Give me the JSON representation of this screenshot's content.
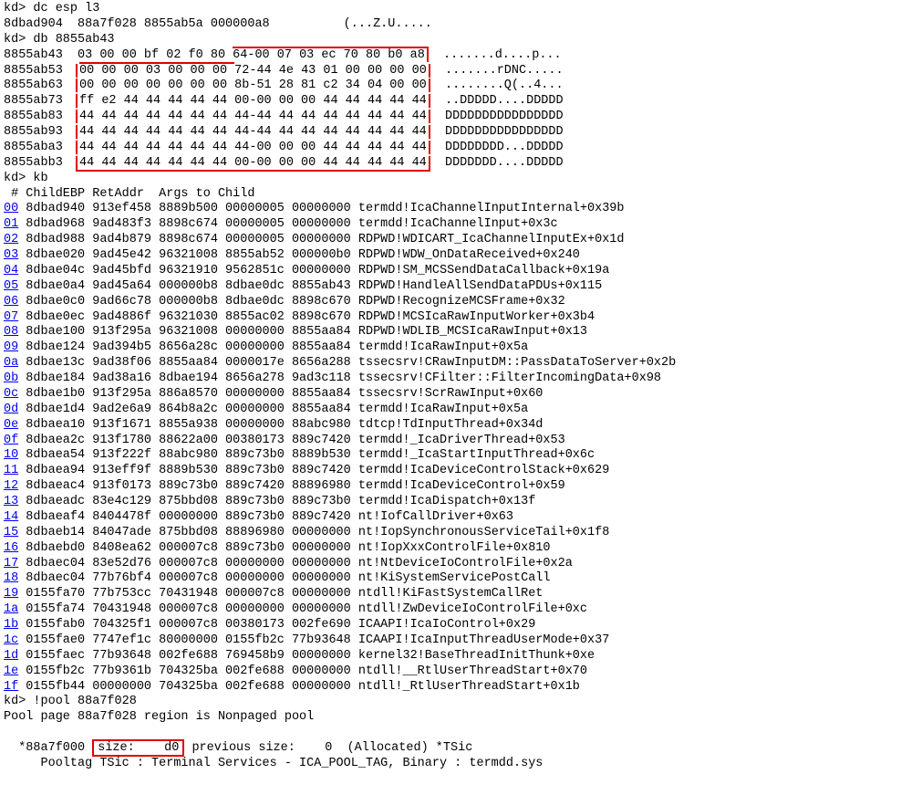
{
  "cmd1": "kd> dc esp l3",
  "dc_row": "8dbad904  88a7f028 8855ab5a 000000a8          (...Z.U.....",
  "cmd2": "kd> db 8855ab43",
  "hexdump": [
    {
      "addr": "8855ab43",
      "hex": "03 00 00 bf 02 f0 80 64-00 07 03 ec 70 80 b0 a8",
      "ascii": ".......d....p..."
    },
    {
      "addr": "8855ab53",
      "hex": "00 00 00 03 00 00 00 72-44 4e 43 01 00 00 00 00",
      "ascii": ".......rDNC....."
    },
    {
      "addr": "8855ab63",
      "hex": "00 00 00 00 00 00 00 8b-51 28 81 c2 34 04 00 00",
      "ascii": "........Q(..4..."
    },
    {
      "addr": "8855ab73",
      "hex": "ff e2 44 44 44 44 44 00-00 00 00 44 44 44 44 44",
      "ascii": "..DDDDD....DDDDD"
    },
    {
      "addr": "8855ab83",
      "hex": "44 44 44 44 44 44 44 44-44 44 44 44 44 44 44 44",
      "ascii": "DDDDDDDDDDDDDDDD"
    },
    {
      "addr": "8855ab93",
      "hex": "44 44 44 44 44 44 44 44-44 44 44 44 44 44 44 44",
      "ascii": "DDDDDDDDDDDDDDDD"
    },
    {
      "addr": "8855aba3",
      "hex": "44 44 44 44 44 44 44 44-00 00 00 44 44 44 44 44",
      "ascii": "DDDDDDDD...DDDDD"
    },
    {
      "addr": "8855abb3",
      "hex": "44 44 44 44 44 44 44 00-00 00 00 44 44 44 44 44",
      "ascii": "DDDDDDD....DDDDD"
    }
  ],
  "cmd3": "kd> kb",
  "stack_header": " # ChildEBP RetAddr  Args to Child",
  "stack": [
    {
      "idx": "00",
      "rest": " 8dbad940 913ef458 8889b500 00000005 00000000 termdd!IcaChannelInputInternal+0x39b"
    },
    {
      "idx": "01",
      "rest": " 8dbad968 9ad483f3 8898c674 00000005 00000000 termdd!IcaChannelInput+0x3c"
    },
    {
      "idx": "02",
      "rest": " 8dbad988 9ad4b879 8898c674 00000005 00000000 RDPWD!WDICART_IcaChannelInputEx+0x1d"
    },
    {
      "idx": "03",
      "rest": " 8dbae020 9ad45e42 96321008 8855ab52 000000b0 RDPWD!WDW_OnDataReceived+0x240"
    },
    {
      "idx": "04",
      "rest": " 8dbae04c 9ad45bfd 96321910 9562851c 00000000 RDPWD!SM_MCSSendDataCallback+0x19a"
    },
    {
      "idx": "05",
      "rest": " 8dbae0a4 9ad45a64 000000b8 8dbae0dc 8855ab43 RDPWD!HandleAllSendDataPDUs+0x115"
    },
    {
      "idx": "06",
      "rest": " 8dbae0c0 9ad66c78 000000b8 8dbae0dc 8898c670 RDPWD!RecognizeMCSFrame+0x32"
    },
    {
      "idx": "07",
      "rest": " 8dbae0ec 9ad4886f 96321030 8855ac02 8898c670 RDPWD!MCSIcaRawInputWorker+0x3b4"
    },
    {
      "idx": "08",
      "rest": " 8dbae100 913f295a 96321008 00000000 8855aa84 RDPWD!WDLIB_MCSIcaRawInput+0x13"
    },
    {
      "idx": "09",
      "rest": " 8dbae124 9ad394b5 8656a28c 00000000 8855aa84 termdd!IcaRawInput+0x5a"
    },
    {
      "idx": "0a",
      "rest": " 8dbae13c 9ad38f06 8855aa84 0000017e 8656a288 tssecsrv!CRawInputDM::PassDataToServer+0x2b"
    },
    {
      "idx": "0b",
      "rest": " 8dbae184 9ad38a16 8dbae194 8656a278 9ad3c118 tssecsrv!CFilter::FilterIncomingData+0x98"
    },
    {
      "idx": "0c",
      "rest": " 8dbae1b0 913f295a 886a8570 00000000 8855aa84 tssecsrv!ScrRawInput+0x60"
    },
    {
      "idx": "0d",
      "rest": " 8dbae1d4 9ad2e6a9 864b8a2c 00000000 8855aa84 termdd!IcaRawInput+0x5a"
    },
    {
      "idx": "0e",
      "rest": " 8dbaea10 913f1671 8855a938 00000000 88abc980 tdtcp!TdInputThread+0x34d"
    },
    {
      "idx": "0f",
      "rest": " 8dbaea2c 913f1780 88622a00 00380173 889c7420 termdd!_IcaDriverThread+0x53"
    },
    {
      "idx": "10",
      "rest": " 8dbaea54 913f222f 88abc980 889c73b0 8889b530 termdd!_IcaStartInputThread+0x6c"
    },
    {
      "idx": "11",
      "rest": " 8dbaea94 913eff9f 8889b530 889c73b0 889c7420 termdd!IcaDeviceControlStack+0x629"
    },
    {
      "idx": "12",
      "rest": " 8dbaeac4 913f0173 889c73b0 889c7420 88896980 termdd!IcaDeviceControl+0x59"
    },
    {
      "idx": "13",
      "rest": " 8dbaeadc 83e4c129 875bbd08 889c73b0 889c73b0 termdd!IcaDispatch+0x13f"
    },
    {
      "idx": "14",
      "rest": " 8dbaeaf4 8404478f 00000000 889c73b0 889c7420 nt!IofCallDriver+0x63"
    },
    {
      "idx": "15",
      "rest": " 8dbaeb14 84047ade 875bbd08 88896980 00000000 nt!IopSynchronousServiceTail+0x1f8"
    },
    {
      "idx": "16",
      "rest": " 8dbaebd0 8408ea62 000007c8 889c73b0 00000000 nt!IopXxxControlFile+0x810"
    },
    {
      "idx": "17",
      "rest": " 8dbaec04 83e52d76 000007c8 00000000 00000000 nt!NtDeviceIoControlFile+0x2a"
    },
    {
      "idx": "18",
      "rest": " 8dbaec04 77b76bf4 000007c8 00000000 00000000 nt!KiSystemServicePostCall"
    },
    {
      "idx": "19",
      "rest": " 0155fa70 77b753cc 70431948 000007c8 00000000 ntdll!KiFastSystemCallRet"
    },
    {
      "idx": "1a",
      "rest": " 0155fa74 70431948 000007c8 00000000 00000000 ntdll!ZwDeviceIoControlFile+0xc"
    },
    {
      "idx": "1b",
      "rest": " 0155fab0 704325f1 000007c8 00380173 002fe690 ICAAPI!IcaIoControl+0x29"
    },
    {
      "idx": "1c",
      "rest": " 0155fae0 7747ef1c 80000000 0155fb2c 77b93648 ICAAPI!IcaInputThreadUserMode+0x37"
    },
    {
      "idx": "1d",
      "rest": " 0155faec 77b93648 002fe688 769458b9 00000000 kernel32!BaseThreadInitThunk+0xe"
    },
    {
      "idx": "1e",
      "rest": " 0155fb2c 77b9361b 704325ba 002fe688 00000000 ntdll!__RtlUserThreadStart+0x70"
    },
    {
      "idx": "1f",
      "rest": " 0155fb44 00000000 704325ba 002fe688 00000000 ntdll!_RtlUserThreadStart+0x1b"
    }
  ],
  "cmd4": "kd> !pool 88a7f028",
  "pool_line": "Pool page 88a7f028 region is Nonpaged pool",
  "pool_star_prefix": "*88a7f000 ",
  "pool_size_label": "size:    d0",
  "pool_star_suffix": " previous size:    0  (Allocated) *TSic",
  "pool_tag_line": "     Pooltag TSic : Terminal Services - ICA_POOL_TAG, Binary : termdd.sys"
}
